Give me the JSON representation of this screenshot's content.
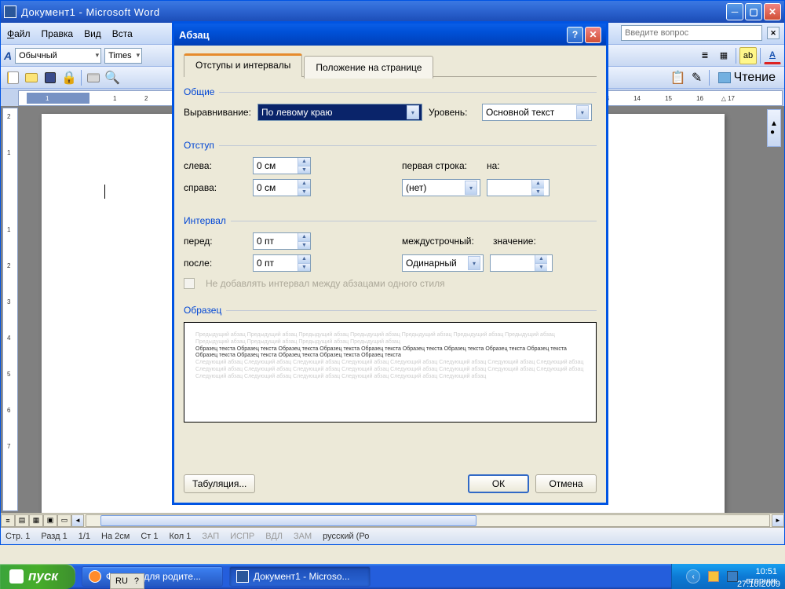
{
  "window": {
    "title": "Документ1 - Microsoft Word",
    "help_placeholder": "Введите вопрос"
  },
  "menubar": {
    "file": "Файл",
    "edit": "Правка",
    "view": "Вид",
    "insert": "Вста"
  },
  "formatting": {
    "style": "Обычный",
    "font": "Times",
    "reading": "Чтение"
  },
  "dialog": {
    "title": "Абзац",
    "tabs": {
      "indents": "Отступы и интервалы",
      "position": "Положение на странице"
    },
    "general": {
      "label": "Общие",
      "align_lbl": "Выравнивание:",
      "align_val": "По левому краю",
      "level_lbl": "Уровень:",
      "level_val": "Основной текст"
    },
    "indent": {
      "label": "Отступ",
      "left_lbl": "слева:",
      "left_val": "0 см",
      "right_lbl": "справа:",
      "right_val": "0 см",
      "firstline_lbl": "первая строка:",
      "firstline_val": "(нет)",
      "by_lbl": "на:"
    },
    "spacing": {
      "label": "Интервал",
      "before_lbl": "перед:",
      "before_val": "0 пт",
      "after_lbl": "после:",
      "after_val": "0 пт",
      "line_lbl": "междустрочный:",
      "line_val": "Одинарный",
      "at_lbl": "значение:",
      "nosame": "Не добавлять интервал между абзацами одного стиля"
    },
    "preview": {
      "label": "Образец",
      "sample": "Образец текста Образец текста Образец текста Образец текста Образец текста Образец текста Образец текста Образец текста Образец текста Образец текста Образец текста Образец текста Образец текста Образец текста"
    },
    "buttons": {
      "tabs": "Табуляция...",
      "ok": "ОК",
      "cancel": "Отмена"
    }
  },
  "statusbar": {
    "page": "Стр. 1",
    "section": "Разд 1",
    "pages": "1/1",
    "at": "На 2см",
    "line": "Ст 1",
    "col": "Кол 1",
    "rec": "ЗАП",
    "trk": "ИСПР",
    "ext": "ВДЛ",
    "ovr": "ЗАМ",
    "lang": "русский (Ро"
  },
  "taskbar": {
    "start": "пуск",
    "task1": "Форумы для родите...",
    "task2": "Документ1 - Microso...",
    "time": "10:51",
    "day": "вторник",
    "date": "27.10.2009",
    "lang": "RU"
  }
}
